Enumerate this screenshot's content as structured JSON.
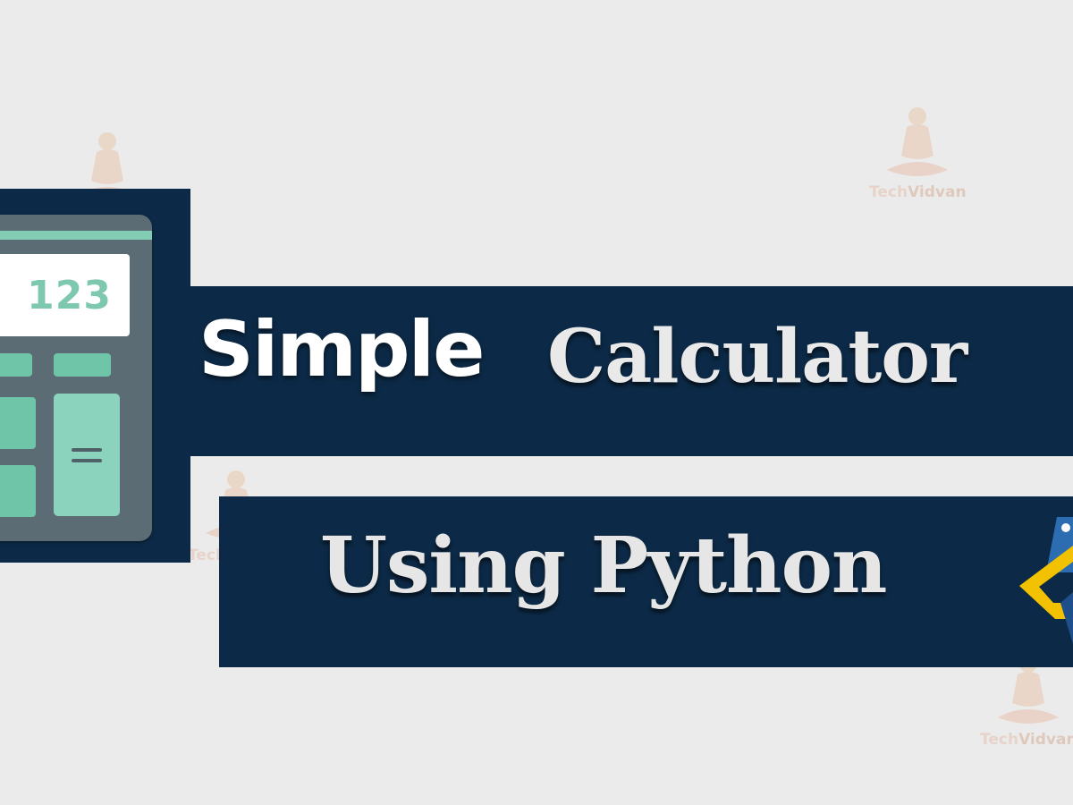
{
  "calculator": {
    "display_value": "123"
  },
  "title": {
    "word1": "Simple",
    "word2": "Calculator"
  },
  "subtitle": "Using Python",
  "watermark": {
    "brand_part1": "Tech",
    "brand_part2": "Vidvan"
  },
  "icons": {
    "calculator": "calculator-icon",
    "python_logo": "python-logo-icon",
    "watermark_logo": "meditating-figure-icon"
  },
  "colors": {
    "background": "#ebebeb",
    "navy": "#0c2a47",
    "calculator_body": "#5b6c75",
    "calculator_keys": "#6fc5a8",
    "python_yellow": "#f2c200",
    "python_blue": "#2c6cb0"
  }
}
